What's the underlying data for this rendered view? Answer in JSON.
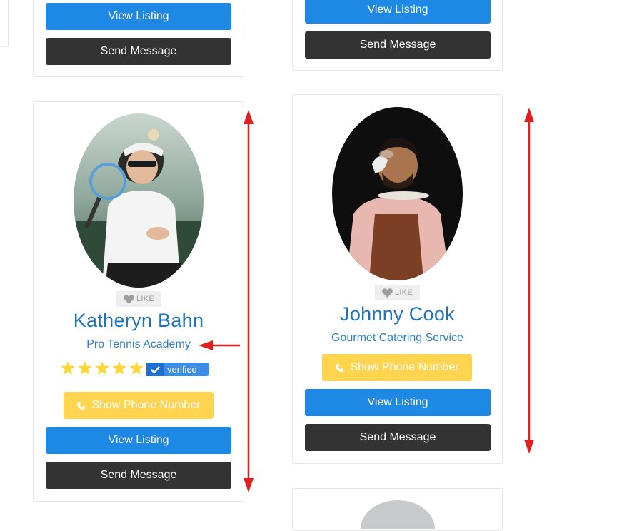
{
  "top_left_card": {
    "view_label": "View Listing",
    "message_label": "Send Message"
  },
  "top_right_card": {
    "view_label": "View Listing",
    "message_label": "Send Message"
  },
  "katheryn_card": {
    "like_label": "LIKE",
    "name": "Katheryn Bahn",
    "business": "Pro Tennis Academy",
    "rating": 5,
    "verified_label": "verified",
    "phone_label": "Show Phone Number",
    "view_label": "View Listing",
    "message_label": "Send Message"
  },
  "johnny_card": {
    "like_label": "LIKE",
    "name": "Johnny Cook",
    "business": "Gourmet Catering Service",
    "phone_label": "Show Phone Number",
    "view_label": "View Listing",
    "message_label": "Send Message"
  },
  "colors": {
    "accent_blue": "#1e88e5",
    "dark_button": "#333333",
    "phone_yellow": "#ffd54f",
    "name_blue": "#1e73be",
    "annotation_red": "#e02020",
    "star_yellow": "#fdd835"
  }
}
